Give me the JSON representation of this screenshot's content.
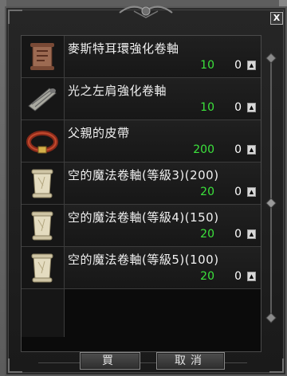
{
  "window": {
    "close_label": "X"
  },
  "items": [
    {
      "name": "麥斯特耳環強化卷軸",
      "price": "10",
      "qty": "0",
      "icon": "scroll-icon"
    },
    {
      "name": "光之左肩強化卷軸",
      "price": "10",
      "qty": "0",
      "icon": "rolled-scroll-icon"
    },
    {
      "name": "父親的皮帶",
      "price": "200",
      "qty": "0",
      "icon": "belt-icon"
    },
    {
      "name": "空的魔法卷軸(等級3)(200)",
      "price": "20",
      "qty": "0",
      "icon": "blank-scroll-icon"
    },
    {
      "name": "空的魔法卷軸(等級4)(150)",
      "price": "20",
      "qty": "0",
      "icon": "blank-scroll-icon"
    },
    {
      "name": "空的魔法卷軸(等級5)(100)",
      "price": "20",
      "qty": "0",
      "icon": "blank-scroll-icon"
    }
  ],
  "buttons": {
    "buy_label": "買",
    "cancel_label": "取消"
  },
  "colors": {
    "price": "#3ce33c",
    "text": "#f0f0f0",
    "panel": "#0b0b0b"
  }
}
